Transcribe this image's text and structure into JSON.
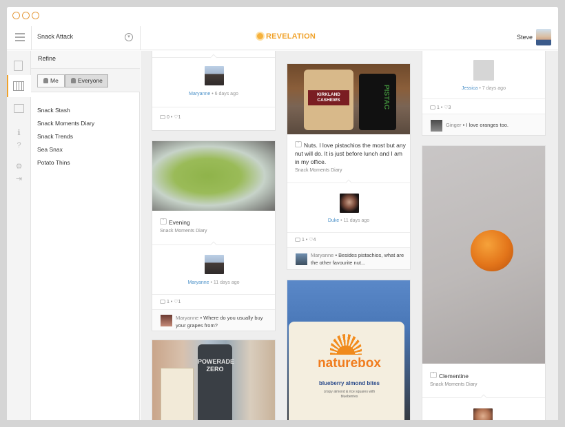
{
  "app": {
    "title": "Snack Attack",
    "logo_text": "REVELATION",
    "user_name": "Steve"
  },
  "sidebar": {
    "refine_label": "Refine",
    "filter_me": "Me",
    "filter_everyone": "Everyone",
    "diaries": [
      "Snack Stash",
      "Snack Moments Diary",
      "Snack Trends",
      "Sea Snax",
      "Potato Thins"
    ]
  },
  "cards": {
    "c1": {
      "poster": "Maryanne",
      "time": "6 days ago",
      "comments": "0",
      "likes": "1"
    },
    "c2": {
      "title": "Evening",
      "diary": "Snack Moments Diary",
      "poster": "Maryanne",
      "time": "11 days ago",
      "comments": "1",
      "likes": "1",
      "comment_author": "Maryanne",
      "comment_text": "Where do you usually buy your grapes from?"
    },
    "c3": {
      "photo_label": "KIRKLAND CASHEWS",
      "photo_label2": "PISTAC",
      "text": "Nuts. I love pistachios the most but any nut will do. It is just before lunch and I am in my office.",
      "diary": "Snack Moments Diary",
      "poster": "Duke",
      "time": "11 days ago",
      "comments": "1",
      "likes": "4",
      "comment_author": "Maryanne",
      "comment_text": "Besides pistachios, what are the other favourite nut..."
    },
    "c4": {
      "photo_label": "POWERADE ZERO"
    },
    "c5": {
      "brand": "naturebox",
      "product": "blueberry almond bites",
      "tagline": "crispy almond & rice squares with blueberries"
    },
    "c6": {
      "poster": "Jessica",
      "time": "7 days ago",
      "comments": "1",
      "likes": "3",
      "comment_author": "Ginger",
      "comment_text": "I love oranges too."
    },
    "c7": {
      "title": "Clementine",
      "diary": "Snack Moments Diary"
    }
  },
  "colors": {
    "accent": "#f0a22a",
    "link": "#4a90c8"
  }
}
